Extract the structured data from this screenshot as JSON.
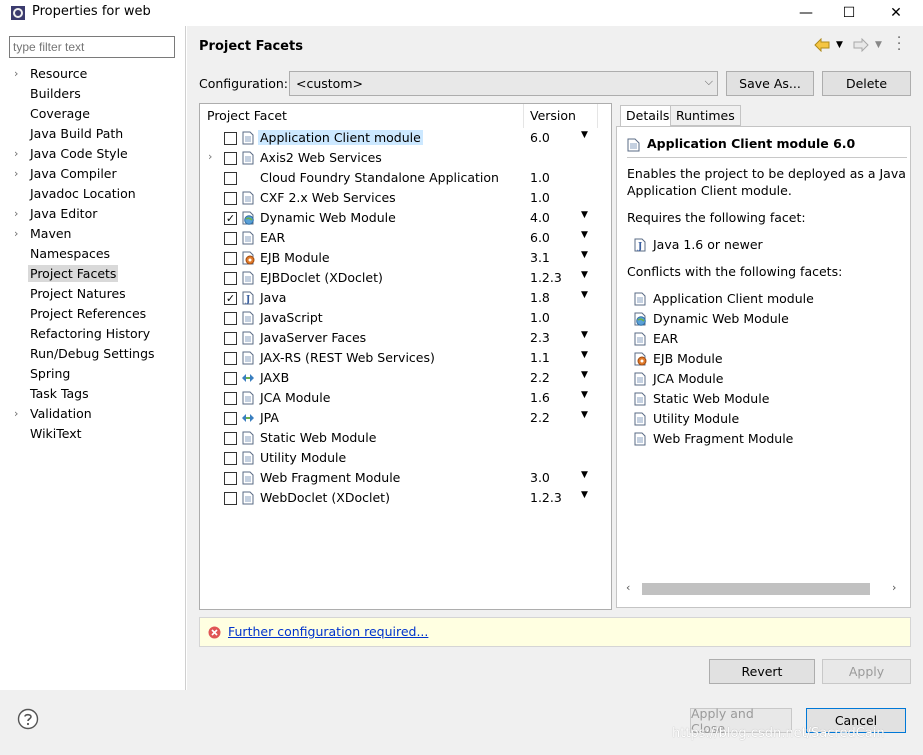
{
  "window": {
    "title": "Properties for web",
    "minimize": "—",
    "maximize": "☐",
    "close": "✕"
  },
  "filter": {
    "placeholder": "type filter text"
  },
  "nav": [
    {
      "label": "Resource",
      "expandable": true
    },
    {
      "label": "Builders",
      "expandable": false
    },
    {
      "label": "Coverage",
      "expandable": false
    },
    {
      "label": "Java Build Path",
      "expandable": false
    },
    {
      "label": "Java Code Style",
      "expandable": true
    },
    {
      "label": "Java Compiler",
      "expandable": true
    },
    {
      "label": "Javadoc Location",
      "expandable": false
    },
    {
      "label": "Java Editor",
      "expandable": true
    },
    {
      "label": "Maven",
      "expandable": true
    },
    {
      "label": "Namespaces",
      "expandable": false
    },
    {
      "label": "Project Facets",
      "expandable": false,
      "selected": true
    },
    {
      "label": "Project Natures",
      "expandable": false
    },
    {
      "label": "Project References",
      "expandable": false
    },
    {
      "label": "Refactoring History",
      "expandable": false
    },
    {
      "label": "Run/Debug Settings",
      "expandable": false
    },
    {
      "label": "Spring",
      "expandable": false
    },
    {
      "label": "Task Tags",
      "expandable": false
    },
    {
      "label": "Validation",
      "expandable": true
    },
    {
      "label": "WikiText",
      "expandable": false
    }
  ],
  "header": {
    "title": "Project Facets"
  },
  "config": {
    "label": "Configuration:",
    "value": "<custom>",
    "save_as": "Save As...",
    "delete": "Delete"
  },
  "facets_table": {
    "col_facet": "Project Facet",
    "col_version": "Version",
    "rows": [
      {
        "name": "Application Client module",
        "version": "6.0",
        "dd": true,
        "checked": false,
        "icon": "doc",
        "selected": true
      },
      {
        "name": "Axis2 Web Services",
        "version": "",
        "dd": false,
        "checked": false,
        "icon": "doc",
        "expand": true
      },
      {
        "name": "Cloud Foundry Standalone Application",
        "version": "1.0",
        "dd": false,
        "checked": false,
        "icon": "none"
      },
      {
        "name": "CXF 2.x Web Services",
        "version": "1.0",
        "dd": false,
        "checked": false,
        "icon": "doc"
      },
      {
        "name": "Dynamic Web Module",
        "version": "4.0",
        "dd": true,
        "checked": true,
        "icon": "globe"
      },
      {
        "name": "EAR",
        "version": "6.0",
        "dd": true,
        "checked": false,
        "icon": "doc"
      },
      {
        "name": "EJB Module",
        "version": "3.1",
        "dd": true,
        "checked": false,
        "icon": "bean"
      },
      {
        "name": "EJBDoclet (XDoclet)",
        "version": "1.2.3",
        "dd": true,
        "checked": false,
        "icon": "doc"
      },
      {
        "name": "Java",
        "version": "1.8",
        "dd": true,
        "checked": true,
        "icon": "java"
      },
      {
        "name": "JavaScript",
        "version": "1.0",
        "dd": false,
        "checked": false,
        "icon": "doc"
      },
      {
        "name": "JavaServer Faces",
        "version": "2.3",
        "dd": true,
        "checked": false,
        "icon": "doc"
      },
      {
        "name": "JAX-RS (REST Web Services)",
        "version": "1.1",
        "dd": true,
        "checked": false,
        "icon": "doc"
      },
      {
        "name": "JAXB",
        "version": "2.2",
        "dd": true,
        "checked": false,
        "icon": "arrows"
      },
      {
        "name": "JCA Module",
        "version": "1.6",
        "dd": true,
        "checked": false,
        "icon": "doc"
      },
      {
        "name": "JPA",
        "version": "2.2",
        "dd": true,
        "checked": false,
        "icon": "arrows"
      },
      {
        "name": "Static Web Module",
        "version": "",
        "dd": false,
        "checked": false,
        "icon": "doc"
      },
      {
        "name": "Utility Module",
        "version": "",
        "dd": false,
        "checked": false,
        "icon": "doc"
      },
      {
        "name": "Web Fragment Module",
        "version": "3.0",
        "dd": true,
        "checked": false,
        "icon": "doc"
      },
      {
        "name": "WebDoclet (XDoclet)",
        "version": "1.2.3",
        "dd": true,
        "checked": false,
        "icon": "doc"
      }
    ]
  },
  "details": {
    "tab_details": "Details",
    "tab_runtimes": "Runtimes",
    "title": "Application Client module 6.0",
    "desc_line1": "Enables the project to be deployed as a Java EE",
    "desc_line2": "Application Client module.",
    "requires_label": "Requires the following facet:",
    "requires": [
      {
        "name": "Java 1.6 or newer",
        "icon": "java"
      }
    ],
    "conflicts_label": "Conflicts with the following facets:",
    "conflicts": [
      {
        "name": "Application Client module",
        "icon": "doc"
      },
      {
        "name": "Dynamic Web Module",
        "icon": "globe"
      },
      {
        "name": "EAR",
        "icon": "doc"
      },
      {
        "name": "EJB Module",
        "icon": "bean"
      },
      {
        "name": "JCA Module",
        "icon": "doc"
      },
      {
        "name": "Static Web Module",
        "icon": "doc"
      },
      {
        "name": "Utility Module",
        "icon": "doc"
      },
      {
        "name": "Web Fragment Module",
        "icon": "doc"
      }
    ]
  },
  "warning": {
    "link": "Further configuration required..."
  },
  "buttons": {
    "revert": "Revert",
    "apply": "Apply",
    "apply_close": "Apply and Close",
    "cancel": "Cancel"
  },
  "watermark": "https://blog.csdn.net/SacredCain"
}
